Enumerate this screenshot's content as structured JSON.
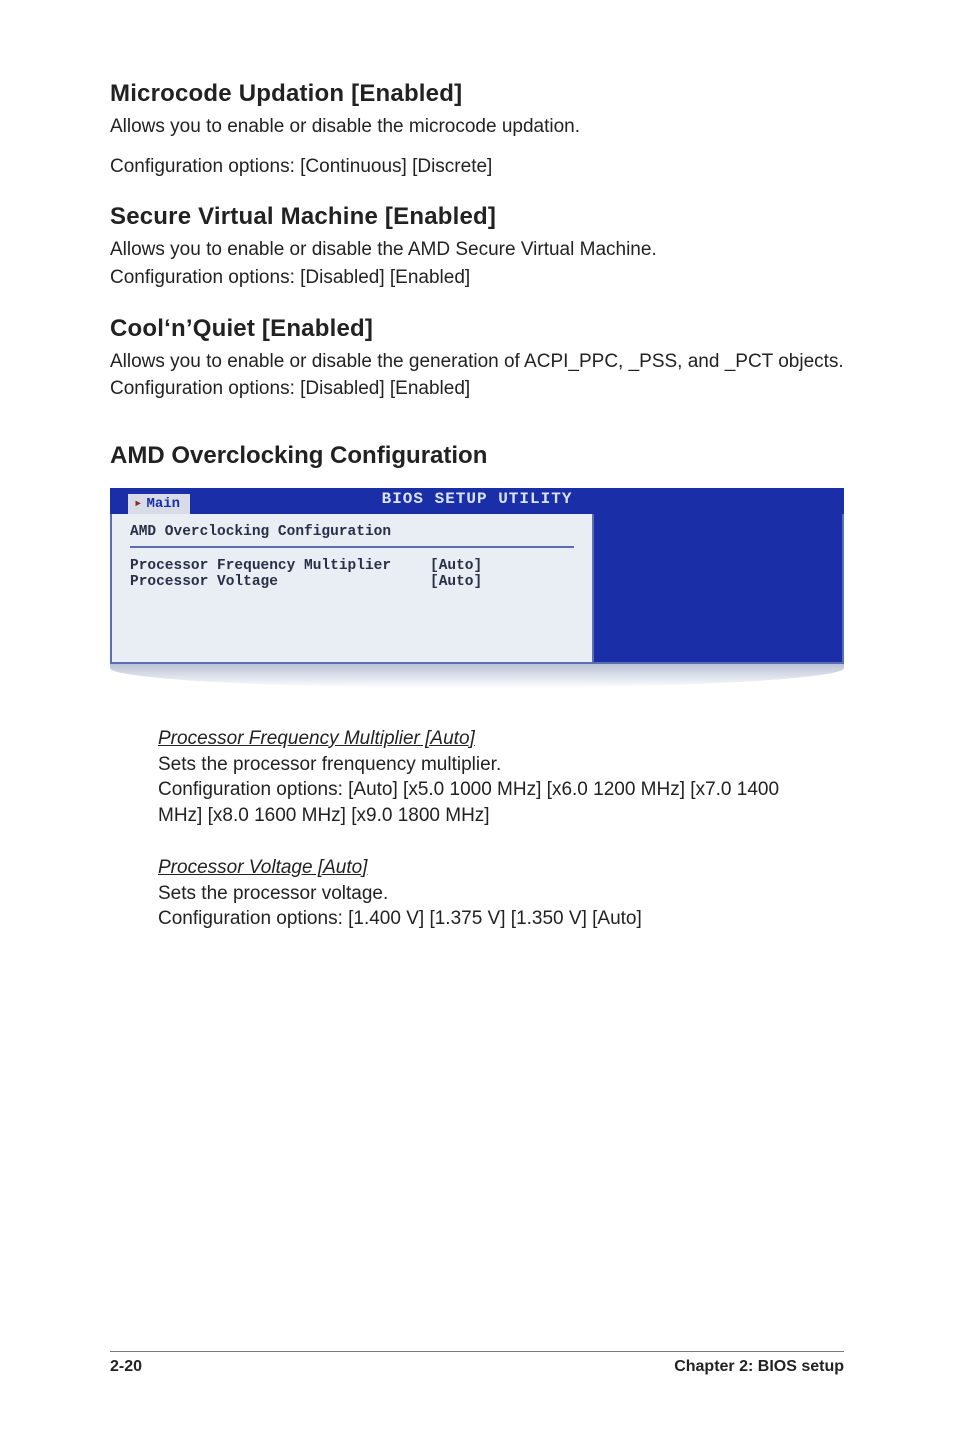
{
  "sections": {
    "microcode": {
      "title": "Microcode Updation [Enabled]",
      "line1": "Allows you to enable or disable the microcode updation.",
      "line2": "Configuration options: [Continuous] [Discrete]"
    },
    "svm": {
      "title": "Secure Virtual Machine [Enabled]",
      "line1": "Allows you to enable or disable the AMD Secure Virtual Machine.",
      "line2": "Configuration options: [Disabled] [Enabled]"
    },
    "cnq": {
      "title": "Cool‘n’Quiet [Enabled]",
      "line1": "Allows you to enable or disable the generation of ACPI_PPC, _PSS, and _PCT objects.",
      "line2": "Configuration options: [Disabled] [Enabled]"
    },
    "amdoc": {
      "title": "AMD Overclocking Configuration"
    }
  },
  "bios": {
    "bar_title": "BIOS SETUP UTILITY",
    "tab": "Main",
    "panel_title": "AMD Overclocking Configuration",
    "rows": [
      {
        "k": "Processor Frequency Multiplier",
        "v": "[Auto]"
      },
      {
        "k": "Processor Voltage",
        "v": "[Auto]"
      }
    ]
  },
  "options": {
    "pfm": {
      "head": "Processor Frequency Multiplier [Auto]",
      "l1": "Sets the processor frenquency multiplier.",
      "l2": "Configuration options: [Auto] [x5.0 1000 MHz] [x6.0 1200 MHz] [x7.0 1400 MHz] [x8.0 1600 MHz] [x9.0 1800 MHz]"
    },
    "pv": {
      "head": "Processor Voltage [Auto]",
      "l1": "Sets the processor voltage.",
      "l2": "Configuration options: [1.400 V] [1.375 V] [1.350 V] [Auto]"
    }
  },
  "footer": {
    "left": "2-20",
    "right": "Chapter 2: BIOS setup"
  }
}
